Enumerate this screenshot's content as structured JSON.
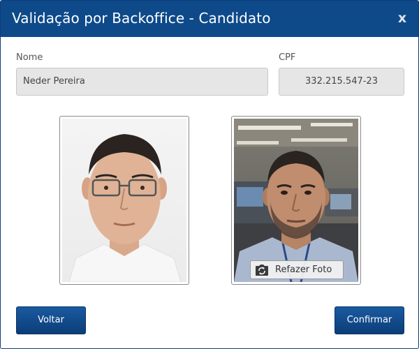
{
  "dialog": {
    "title": "Validação por Backoffice - Candidato",
    "close_label": "x"
  },
  "form": {
    "name_label": "Nome",
    "name_value": "Neder Pereira",
    "cpf_label": "CPF",
    "cpf_value": "332.215.547-23"
  },
  "photos": {
    "reference_photo": "candidate-reference-photo",
    "captured_photo": "candidate-captured-photo",
    "retake_label": "Refazer Foto",
    "retake_icon": "camera-rotate-icon"
  },
  "actions": {
    "back_label": "Voltar",
    "confirm_label": "Confirmar"
  },
  "colors": {
    "header": "#0e4a8a",
    "button": "#0b3d78",
    "field_bg": "#e6e6e6"
  }
}
